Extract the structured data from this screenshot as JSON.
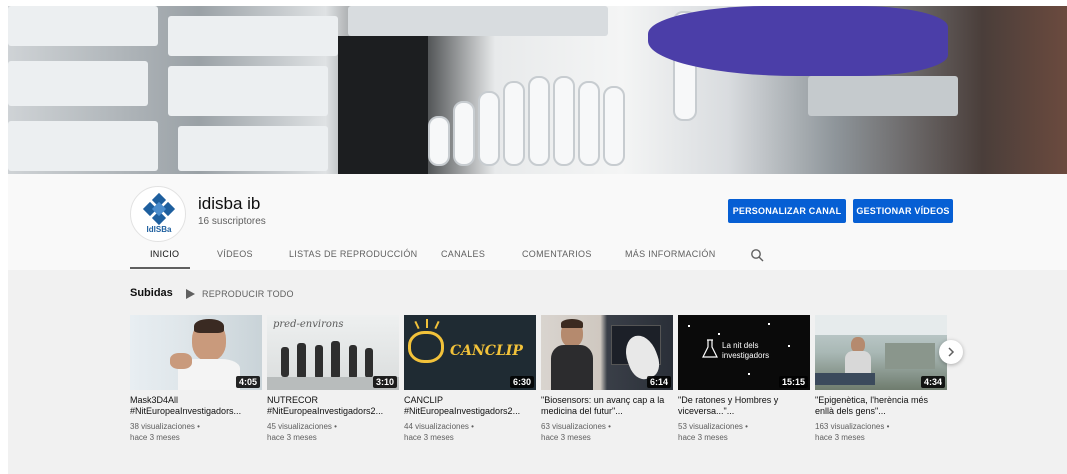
{
  "channel": {
    "name": "idisba ib",
    "subscribers": "16 suscriptores",
    "logo_text": "IdISBa"
  },
  "buttons": {
    "customize": "PERSONALIZAR CANAL",
    "manage": "GESTIONAR VÍDEOS"
  },
  "tabs": [
    {
      "label": "INICIO",
      "active": true
    },
    {
      "label": "VÍDEOS"
    },
    {
      "label": "LISTAS DE REPRODUCCIÓN"
    },
    {
      "label": "CANALES"
    },
    {
      "label": "COMENTARIOS"
    },
    {
      "label": "MÁS INFORMACIÓN"
    }
  ],
  "section": {
    "title": "Subidas",
    "play_all": "REPRODUCIR TODO"
  },
  "videos": [
    {
      "title": "Mask3D4All #NitEuropeaInvestigadors...",
      "views": "38 visualizaciones •",
      "age": "hace 3 meses",
      "duration": "4:05",
      "thumb_text": ""
    },
    {
      "title": "NUTRECOR #NitEuropeaInvestigadors2...",
      "views": "45 visualizaciones •",
      "age": "hace 3 meses",
      "duration": "3:10",
      "thumb_text": "pred-environs"
    },
    {
      "title": "CANCLIP #NitEuropeaInvestigadors2...",
      "views": "44 visualizaciones •",
      "age": "hace 3 meses",
      "duration": "6:30",
      "thumb_text": "CANCLIP"
    },
    {
      "title": "\"Biosensors: un avanç cap a la medicina del futur\"...",
      "views": "63 visualizaciones •",
      "age": "hace 3 meses",
      "duration": "6:14",
      "thumb_text": ""
    },
    {
      "title": "\"De ratones y Hombres y viceversa...\"...",
      "views": "53 visualizaciones •",
      "age": "hace 3 meses",
      "duration": "15:15",
      "thumb_text": "La nit dels investigadors"
    },
    {
      "title": "\"Epigenètica, l'herència més enllà dels gens\"...",
      "views": "163 visualizaciones •",
      "age": "hace 3 meses",
      "duration": "4:34",
      "thumb_text": ""
    }
  ],
  "colors": {
    "primary_button": "#065fd4",
    "logo_blue": "#1e5f9e"
  }
}
